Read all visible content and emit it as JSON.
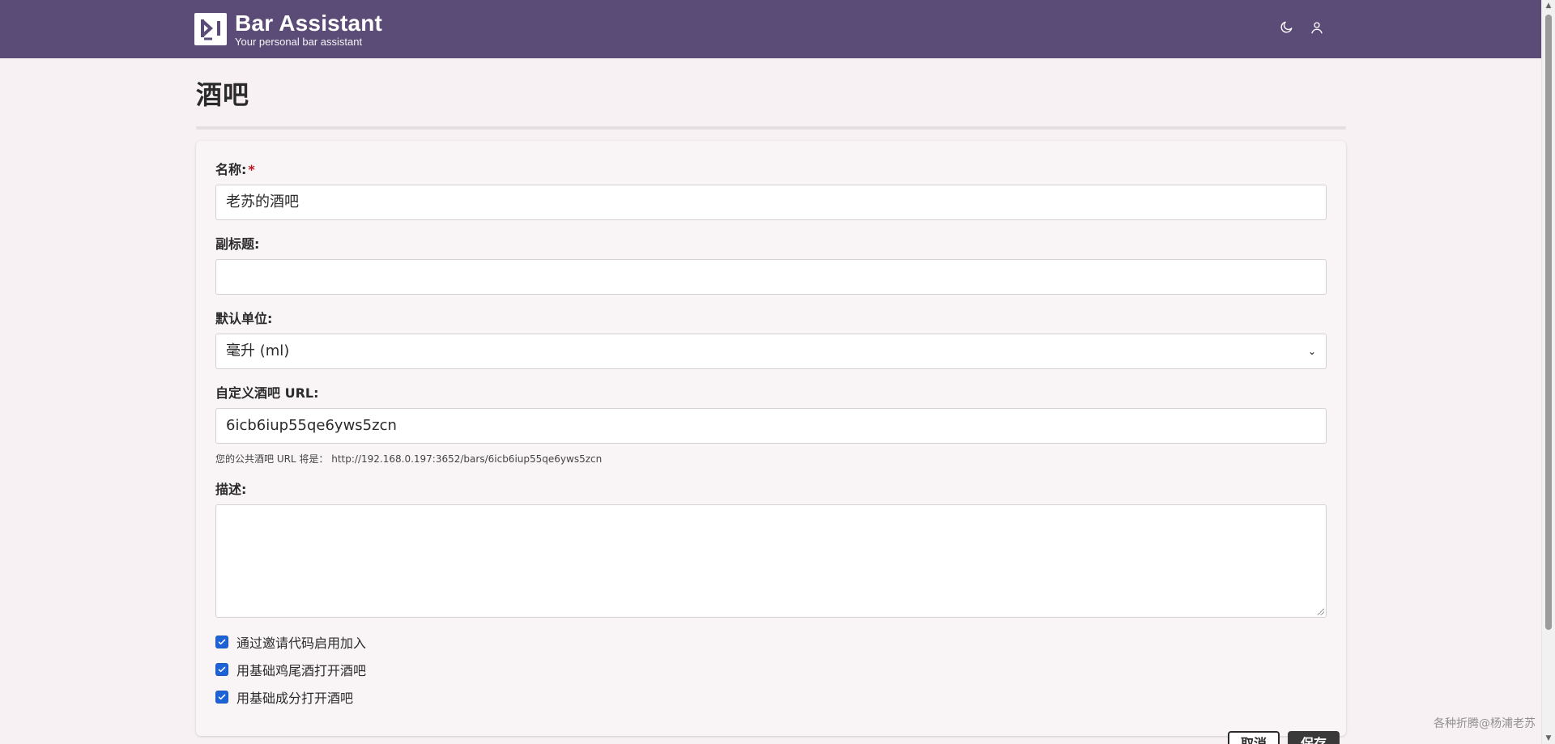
{
  "header": {
    "app_title": "Bar Assistant",
    "app_subtitle": "Your personal bar assistant",
    "icons": {
      "theme_toggle": "moon-icon",
      "profile": "user-icon"
    }
  },
  "page": {
    "title": "酒吧"
  },
  "form": {
    "name": {
      "label": "名称:",
      "required_mark": "*",
      "value": "老苏的酒吧"
    },
    "subtitle": {
      "label": "副标题:",
      "value": ""
    },
    "default_unit": {
      "label": "默认单位:",
      "selected": "毫升 (ml)"
    },
    "custom_url": {
      "label": "自定义酒吧 URL:",
      "value": "6icb6iup55qe6yws5zcn",
      "help": "您的公共酒吧 URL 将是： http://192.168.0.197:3652/bars/6icb6iup55qe6yws5zcn"
    },
    "description": {
      "label": "描述:",
      "value": ""
    },
    "checkboxes": [
      {
        "label": "通过邀请代码启用加入",
        "checked": true
      },
      {
        "label": "用基础鸡尾酒打开酒吧",
        "checked": true
      },
      {
        "label": "用基础成分打开酒吧",
        "checked": true
      }
    ]
  },
  "actions": {
    "cancel": "取消",
    "save": "保存"
  },
  "watermark": "各种折腾@杨浦老苏",
  "colors": {
    "header_bg": "#5b4b77",
    "page_bg": "#f7f1f3",
    "checkbox": "#1e63d6",
    "required": "#c1121f"
  }
}
